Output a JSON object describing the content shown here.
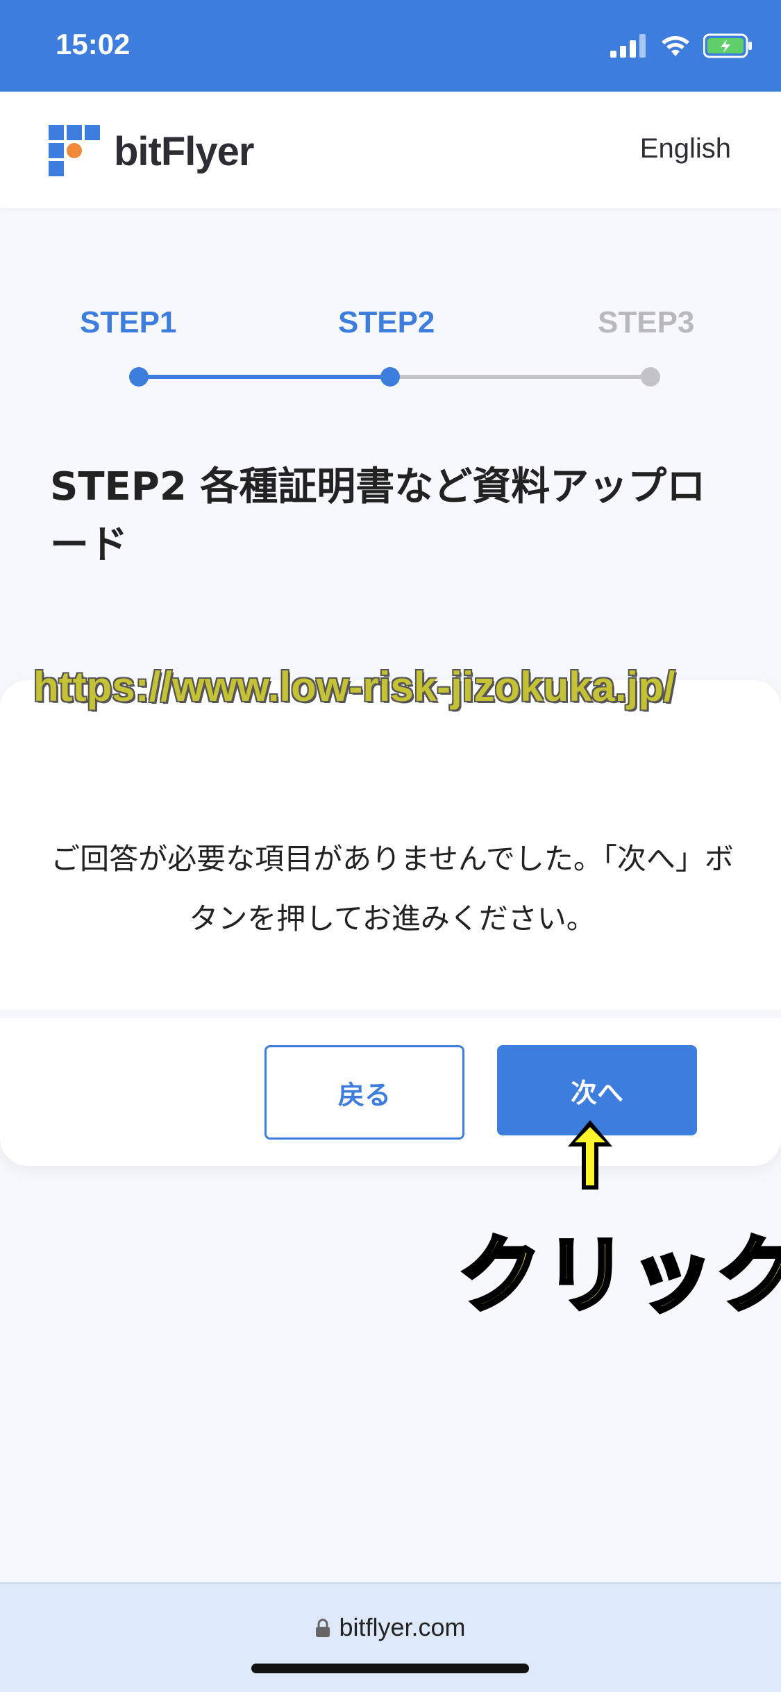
{
  "status": {
    "time": "15:02"
  },
  "header": {
    "brand": "bitFlyer",
    "language_link": "English"
  },
  "steps": [
    {
      "label": "STEP1",
      "state": "done"
    },
    {
      "label": "STEP2",
      "state": "current"
    },
    {
      "label": "STEP3",
      "state": "upcoming"
    }
  ],
  "page": {
    "heading": "STEP2 各種証明書など資料アップロード",
    "watermark": "https://www.low-risk-jizokuka.jp/",
    "message": "ご回答が必要な項目がありませんでした。「次へ」ボタンを押してお進みください。"
  },
  "buttons": {
    "back": "戻る",
    "next": "次へ"
  },
  "annotation": {
    "label": "クリック"
  },
  "browser": {
    "url": "bitflyer.com"
  },
  "colors": {
    "accent": "#3c7ddd",
    "inactive": "#b9b9bd",
    "annotation": "#fff52a"
  }
}
